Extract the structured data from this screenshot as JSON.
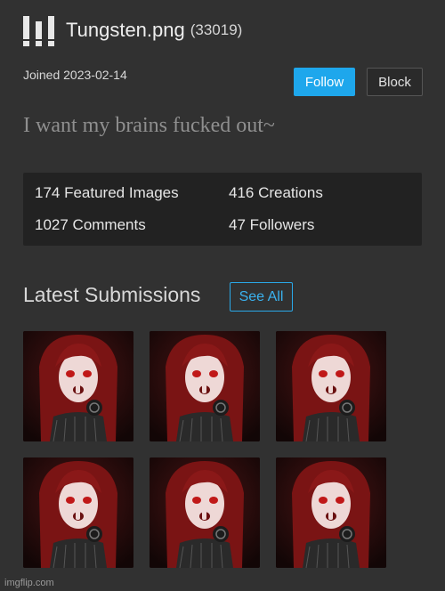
{
  "profile": {
    "username": "Tungsten.png",
    "user_id": "(33019)",
    "joined": "Joined 2023-02-14",
    "follow_label": "Follow",
    "block_label": "Block",
    "bio": "I want my brains fucked out~"
  },
  "stats": {
    "featured": "174 Featured Images",
    "creations": "416 Creations",
    "comments": "1027 Comments",
    "followers": "47 Followers"
  },
  "latest": {
    "title": "Latest Submissions",
    "see_all_label": "See All",
    "thumbnail_count": 6
  },
  "footer": {
    "watermark": "imgflip.com"
  },
  "colors": {
    "accent": "#1ea7ec",
    "background": "#313131",
    "panel": "#222222"
  }
}
